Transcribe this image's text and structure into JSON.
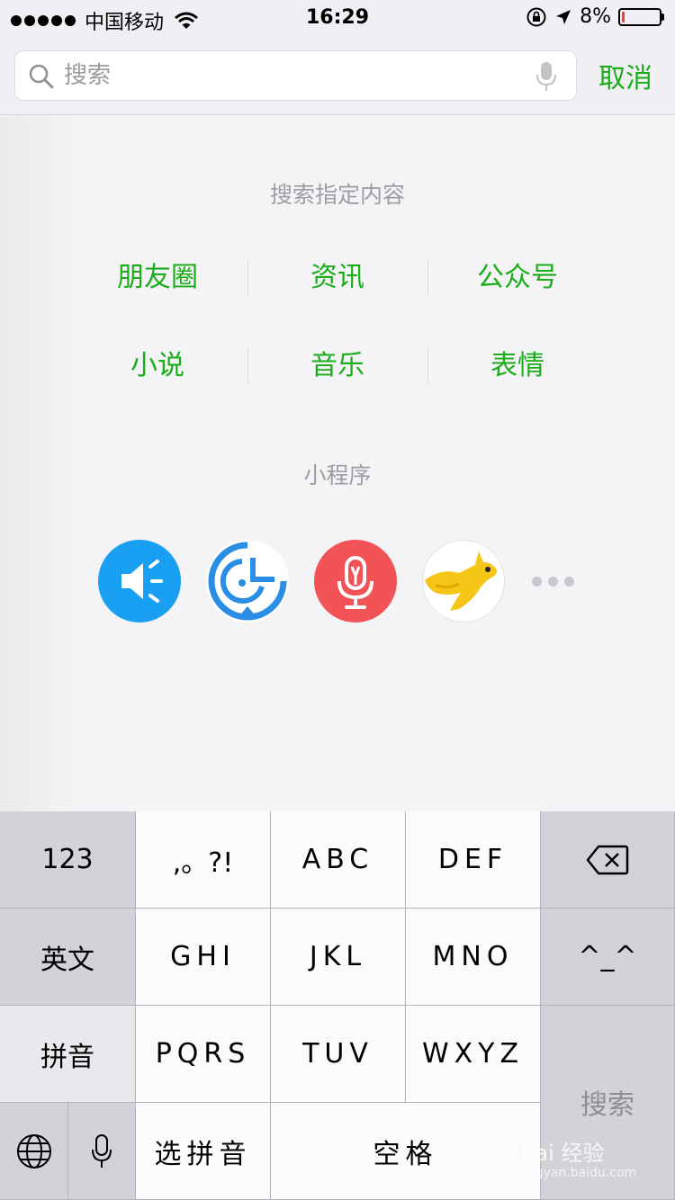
{
  "status_bar": {
    "carrier": "中国移动",
    "time": "16:29",
    "battery_percent": "8%",
    "battery_level": 0.08
  },
  "search": {
    "placeholder": "搜索",
    "cancel_label": "取消"
  },
  "search_specific": {
    "title": "搜索指定内容",
    "rows": [
      [
        "朋友圈",
        "资讯",
        "公众号"
      ],
      [
        "小说",
        "音乐",
        "表情"
      ]
    ]
  },
  "mini_programs": {
    "title": "小程序",
    "apps": [
      "speaker-app-icon",
      "timer-app-icon",
      "voice-app-icon",
      "kangaroo-app-icon"
    ]
  },
  "keyboard": {
    "num_key": "123",
    "punct_key": ",。?!",
    "abc": "ABC",
    "def": "DEF",
    "english_key": "英文",
    "ghi": "GHI",
    "jkl": "JKL",
    "mno": "MNO",
    "emoticon_key": "^_^",
    "pinyin_key": "拼音",
    "pqrs": "PQRS",
    "tuv": "TUV",
    "wxyz": "WXYZ",
    "search_key": "搜索",
    "select_pinyin_key": "选拼音",
    "space_key": "空格"
  },
  "watermark": {
    "brand": "Bai 经验",
    "url": "jingyan.baidu.com"
  }
}
